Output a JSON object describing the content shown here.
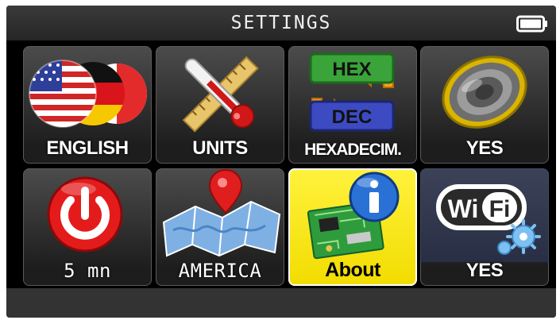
{
  "header": {
    "title": "SETTINGS",
    "battery_icon": "battery-full-icon"
  },
  "tiles": [
    {
      "label": "ENGLISH",
      "icon": "language-flags-icon"
    },
    {
      "label": "UNITS",
      "icon": "ruler-thermometer-icon"
    },
    {
      "label": "HEXADECIM.",
      "icon": "hex-dec-swap-icon",
      "icon_text": [
        "HEX",
        "DEC"
      ]
    },
    {
      "label": "YES",
      "icon": "speaker-icon"
    },
    {
      "label": "5 mn",
      "icon": "power-icon"
    },
    {
      "label": "AMERICA",
      "icon": "map-pin-icon"
    },
    {
      "label": "About",
      "icon": "info-board-icon"
    },
    {
      "label": "YES",
      "icon": "wifi-gear-icon",
      "icon_text": [
        "Wi",
        "Fi"
      ]
    }
  ],
  "colors": {
    "highlight_tile": "#f2dc00",
    "screen_background": "#000000",
    "title_text": "#f0f0f0"
  }
}
